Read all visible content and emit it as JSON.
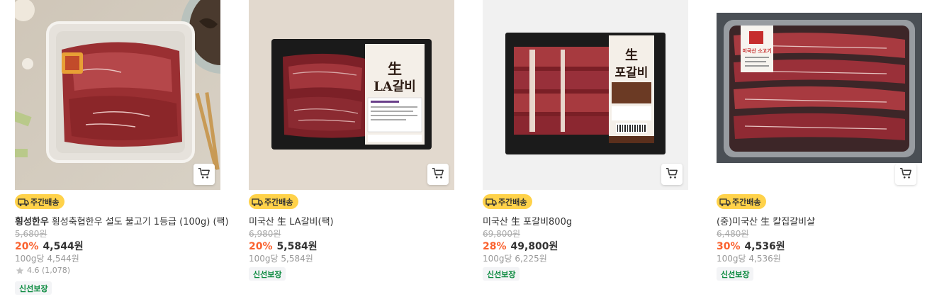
{
  "products": [
    {
      "badge": "주간배송",
      "brand": "횡성한우",
      "name": "횡성축협한우 설도 불고기 1등급 (100g) (팩)",
      "original_price": "5,680원",
      "discount": "20%",
      "price": "4,544원",
      "unit_price": "100g당 4,544원",
      "rating": "4.6 (1,078)",
      "tag": "신선보장"
    },
    {
      "badge": "주간배송",
      "brand": "",
      "name": "미국산 生 LA갈비(팩)",
      "original_price": "6,980원",
      "discount": "20%",
      "price": "5,584원",
      "unit_price": "100g당 5,584원",
      "rating": "",
      "tag": "신선보장"
    },
    {
      "badge": "주간배송",
      "brand": "",
      "name": "미국산 生 포갈비800g",
      "original_price": "69,800원",
      "discount": "28%",
      "price": "49,800원",
      "unit_price": "100g당 6,225원",
      "rating": "",
      "tag": "신선보장"
    },
    {
      "badge": "주간배송",
      "brand": "",
      "name": "(중)미국산 生 칼집갈비살",
      "original_price": "6,480원",
      "discount": "30%",
      "price": "4,536원",
      "unit_price": "100g당 4,536원",
      "rating": "",
      "tag": "신선보장"
    }
  ],
  "package_labels": {
    "p2_top": "生",
    "p2_main": "LA갈비",
    "p3_top": "生",
    "p3_main": "포갈비",
    "p4_main": "미국산 소고기"
  },
  "icons": {
    "cart": "cart-icon",
    "truck": "delivery-truck-icon",
    "star": "star-icon"
  },
  "colors": {
    "badge_bg": "#ffd24a",
    "discount": "#fa622f",
    "fresh_tag": "#0a8a3e"
  }
}
